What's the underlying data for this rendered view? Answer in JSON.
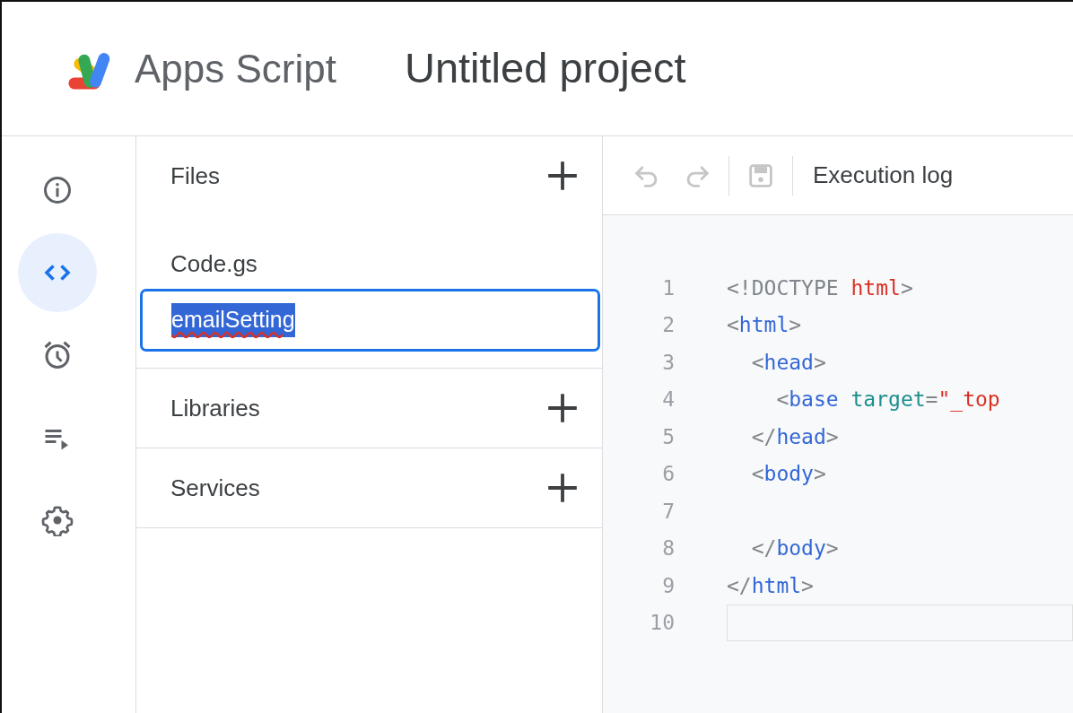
{
  "app": {
    "name": "Apps Script"
  },
  "project": {
    "title": "Untitled project"
  },
  "rail": [
    {
      "kind": "info",
      "selected": false
    },
    {
      "kind": "code",
      "selected": true
    },
    {
      "kind": "alarm",
      "selected": false
    },
    {
      "kind": "queue",
      "selected": false
    },
    {
      "kind": "gear",
      "selected": false
    }
  ],
  "files_panel": {
    "sections": [
      {
        "title": "Files",
        "files": [
          {
            "name": "Code.gs"
          }
        ],
        "renaming": {
          "value": "emailSetting",
          "text_selected": true,
          "spelling_flagged": true
        }
      },
      {
        "title": "Libraries"
      },
      {
        "title": "Services"
      }
    ]
  },
  "toolbar": {
    "undo": {
      "disabled": true
    },
    "redo": {
      "disabled": true
    },
    "save": {
      "disabled": true
    },
    "execution_log": "Execution log"
  },
  "editor": {
    "lines": [
      {
        "number": "1",
        "current": false,
        "tokens": [
          {
            "text": "<!DOCTYPE ",
            "kind": "punct"
          },
          {
            "text": "html",
            "kind": "string"
          },
          {
            "text": ">",
            "kind": "punct"
          }
        ]
      },
      {
        "number": "2",
        "current": false,
        "tokens": [
          {
            "text": "<",
            "kind": "punct"
          },
          {
            "text": "html",
            "kind": "tag"
          },
          {
            "text": ">",
            "kind": "punct"
          }
        ]
      },
      {
        "number": "3",
        "current": false,
        "tokens": [
          {
            "text": "  <",
            "kind": "punct"
          },
          {
            "text": "head",
            "kind": "tag"
          },
          {
            "text": ">",
            "kind": "punct"
          }
        ]
      },
      {
        "number": "4",
        "current": false,
        "tokens": [
          {
            "text": "    <",
            "kind": "punct"
          },
          {
            "text": "base",
            "kind": "tag"
          },
          {
            "text": " target",
            "kind": "attr"
          },
          {
            "text": "=",
            "kind": "punct"
          },
          {
            "text": "\"_top",
            "kind": "string"
          }
        ]
      },
      {
        "number": "5",
        "current": false,
        "tokens": [
          {
            "text": "  </",
            "kind": "punct"
          },
          {
            "text": "head",
            "kind": "tag"
          },
          {
            "text": ">",
            "kind": "punct"
          }
        ]
      },
      {
        "number": "6",
        "current": false,
        "tokens": [
          {
            "text": "  <",
            "kind": "punct"
          },
          {
            "text": "body",
            "kind": "tag"
          },
          {
            "text": ">",
            "kind": "punct"
          }
        ]
      },
      {
        "number": "7",
        "current": false
      },
      {
        "number": "8",
        "current": false,
        "tokens": [
          {
            "text": "  </",
            "kind": "punct"
          },
          {
            "text": "body",
            "kind": "tag"
          },
          {
            "text": ">",
            "kind": "punct"
          }
        ]
      },
      {
        "number": "9",
        "current": false,
        "tokens": [
          {
            "text": "</",
            "kind": "punct"
          },
          {
            "text": "html",
            "kind": "tag"
          },
          {
            "text": ">",
            "kind": "punct"
          }
        ]
      },
      {
        "number": "10",
        "current": true
      }
    ]
  }
}
